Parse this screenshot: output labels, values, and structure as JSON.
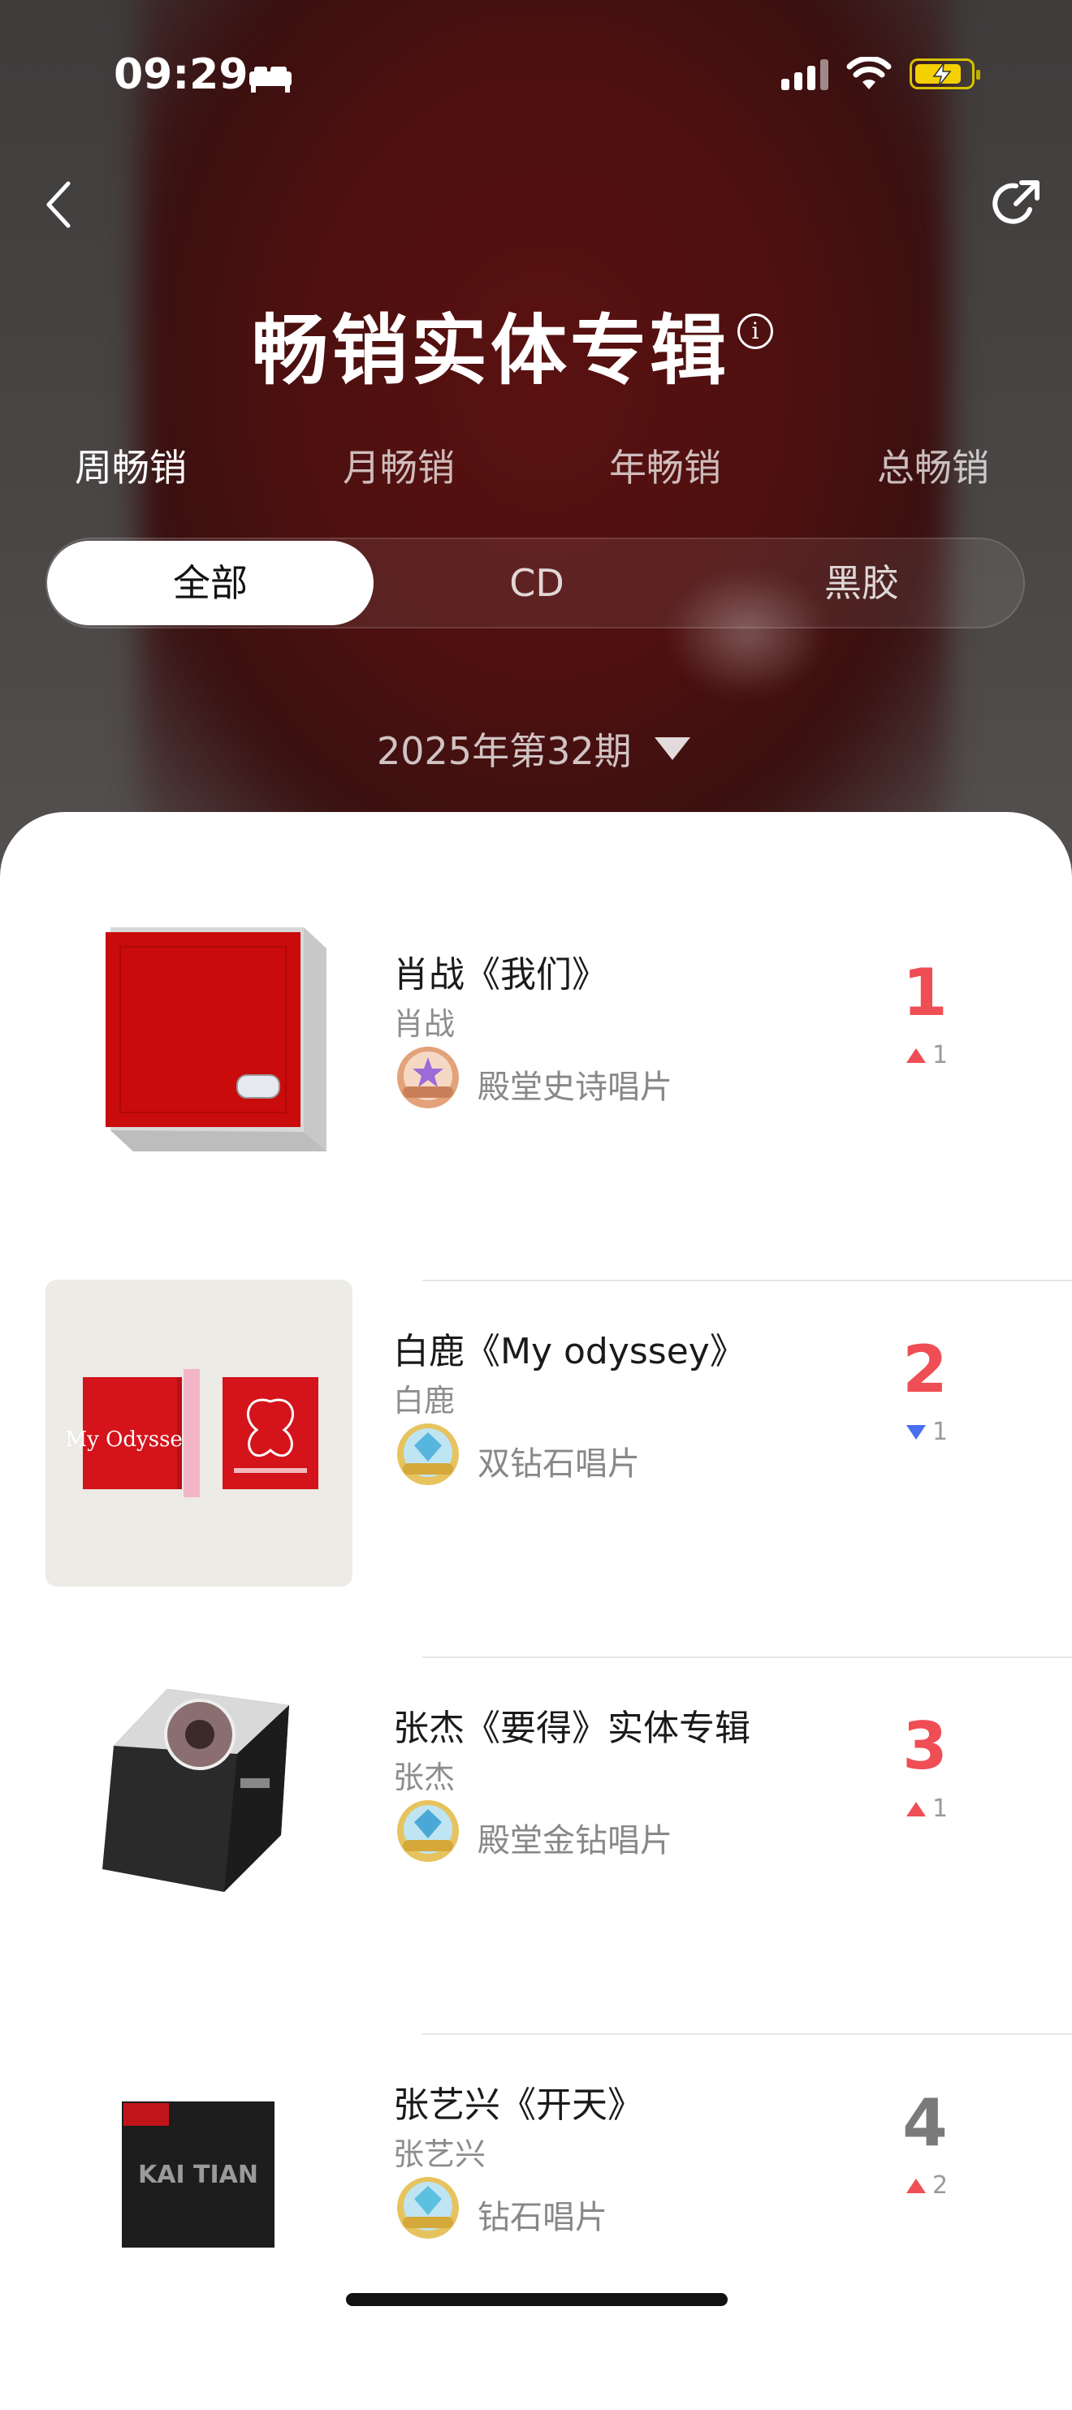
{
  "status": {
    "time": "09:29"
  },
  "header": {
    "title": "畅销实体专辑"
  },
  "period_tabs": [
    {
      "label": "周畅销",
      "active": true
    },
    {
      "label": "月畅销",
      "active": false
    },
    {
      "label": "年畅销",
      "active": false
    },
    {
      "label": "总畅销",
      "active": false
    }
  ],
  "format_tabs": [
    {
      "label": "全部",
      "active": true
    },
    {
      "label": "CD",
      "active": false
    },
    {
      "label": "黑胶",
      "active": false
    }
  ],
  "period_select": {
    "value": "2025年第32期"
  },
  "list": [
    {
      "rank": "1",
      "title": "肖战《我们》",
      "artist": "肖战",
      "badge": "殿堂史诗唱片",
      "change_dir": "up",
      "change": "1"
    },
    {
      "rank": "2",
      "title": "白鹿《My odyssey》",
      "artist": "白鹿",
      "badge": "双钻石唱片",
      "change_dir": "down",
      "change": "1"
    },
    {
      "rank": "3",
      "title": "张杰《要得》实体专辑",
      "artist": "张杰",
      "badge": "殿堂金钻唱片",
      "change_dir": "up",
      "change": "1"
    },
    {
      "rank": "4",
      "title": "张艺兴《开天》",
      "artist": "张艺兴",
      "badge": "钻石唱片",
      "change_dir": "up",
      "change": "2"
    }
  ],
  "covers": {
    "cover4_text": "KAI TIAN",
    "cover2_text": "My Odyssey"
  },
  "colors": {
    "rank_red": "#ef4e55",
    "rank_gray": "#7a7a7a",
    "down_blue": "#4a6ef0"
  }
}
